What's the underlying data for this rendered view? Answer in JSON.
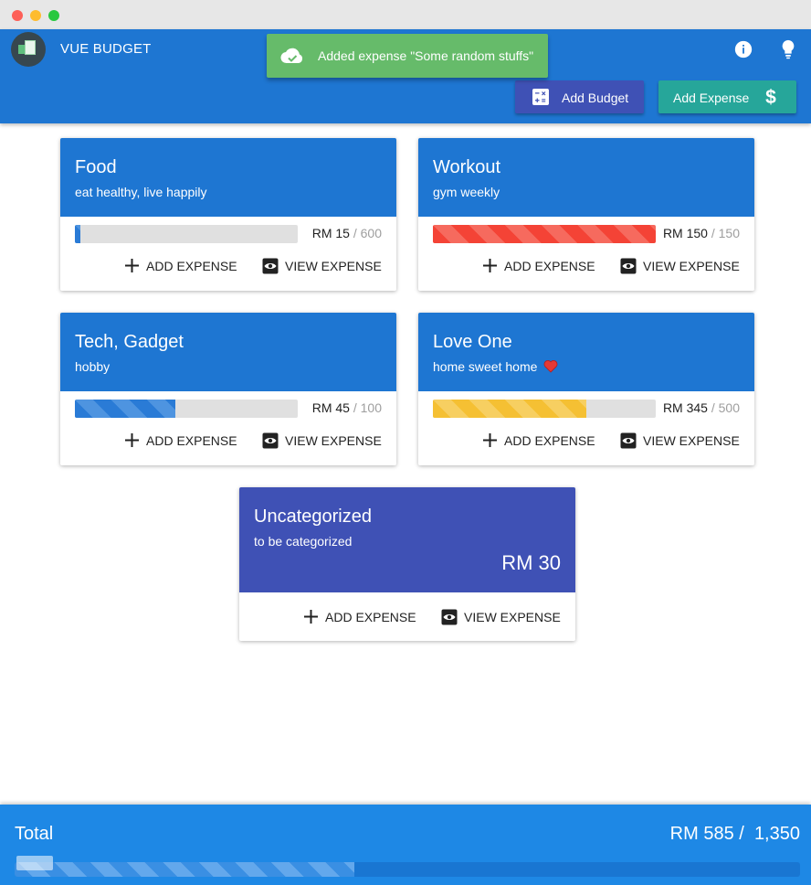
{
  "app": {
    "title": "VUE BUDGET"
  },
  "toolbar": {
    "add_budget_label": "Add Budget",
    "add_expense_label": "Add Expense",
    "info_icon": "info-icon",
    "lightbulb_icon": "lightbulb-icon"
  },
  "snackbar": {
    "message": "Added expense \"Some random stuffs\""
  },
  "actions": {
    "add_expense": "ADD EXPENSE",
    "view_expense": "VIEW EXPENSE"
  },
  "budgets": [
    {
      "title": "Food",
      "subtitle": "eat healthy, live happily",
      "spent": "RM 15",
      "total": "600",
      "progress": 0.025,
      "bar_color": "blue"
    },
    {
      "title": "Workout",
      "subtitle": "gym weekly",
      "spent": "RM 150",
      "total": "150",
      "progress": 1.0,
      "bar_color": "red"
    },
    {
      "title": "Tech, Gadget",
      "subtitle": "hobby",
      "spent": "RM 45",
      "total": "100",
      "progress": 0.45,
      "bar_color": "blue"
    },
    {
      "title": "Love One",
      "subtitle": "home sweet home",
      "spent": "RM 345",
      "total": "500",
      "progress": 0.69,
      "bar_color": "yellow"
    }
  ],
  "uncategorized": {
    "title": "Uncategorized",
    "subtitle": "to be categorized",
    "amount": "RM 30"
  },
  "footer": {
    "label": "Total",
    "spent": "RM 585",
    "total": "1,350",
    "progress": 0.433
  },
  "colors": {
    "primary": "#1e76d2",
    "indigo": "#3f51b5",
    "teal": "#26a69a",
    "success": "#66bb6a",
    "danger": "#f44336",
    "warning": "#f5c033",
    "footer": "#1e88e5"
  }
}
